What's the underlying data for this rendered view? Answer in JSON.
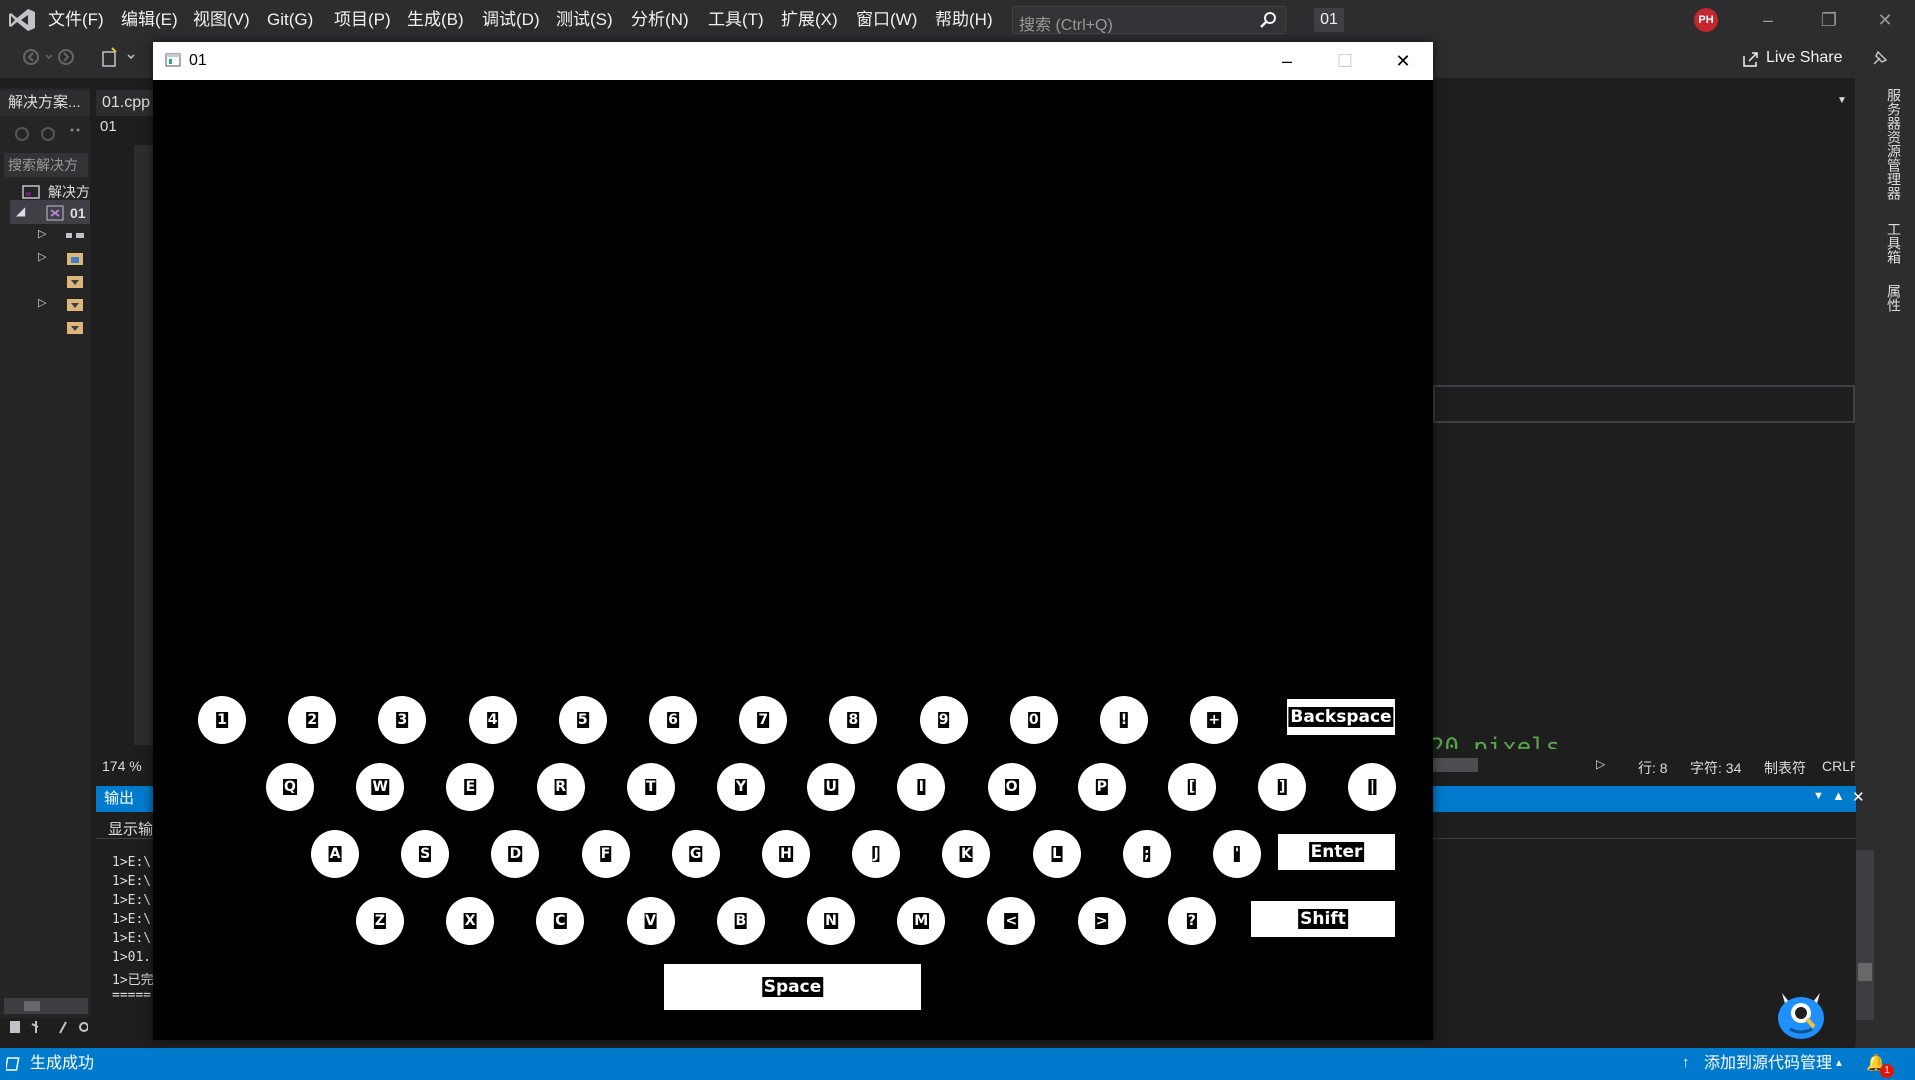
{
  "menubar": {
    "items": [
      "文件(F)",
      "编辑(E)",
      "视图(V)",
      "Git(G)",
      "项目(P)",
      "生成(B)",
      "调试(D)",
      "测试(S)",
      "分析(N)",
      "工具(T)",
      "扩展(X)",
      "窗口(W)",
      "帮助(H)"
    ],
    "search_placeholder": "搜索 (Ctrl+Q)",
    "solution_name": "01",
    "avatar_initials": "PH"
  },
  "toolbar": {
    "live_share": "Live Share"
  },
  "solution_explorer": {
    "header": "解决方案...",
    "search": "搜索解决方",
    "solution_label": "解决方",
    "project_label": "01"
  },
  "editor": {
    "tab": "01.cpp",
    "nav_project": "01",
    "zoom": "174 %",
    "code_fragment": "20 pixels",
    "line": "行: 8",
    "char": "字符: 34",
    "indent": "制表符",
    "eol": "CRLF"
  },
  "right_strip": {
    "tabs": [
      "服务器资源管理器",
      "工具箱",
      "属性"
    ]
  },
  "output_panel": {
    "title": "输出",
    "show_output": "显示输",
    "lines": [
      "1>E:\\",
      "1>E:\\",
      "1>E:\\",
      "1>E:\\",
      "1>E:\\",
      "1>01.",
      "1>已完",
      "====="
    ]
  },
  "statusbar": {
    "build_status": "生成成功",
    "source_control": "添加到源代码管理",
    "notifications": "1"
  },
  "app_window": {
    "title": "01",
    "keyboard": {
      "row1": [
        "1",
        "2",
        "3",
        "4",
        "5",
        "6",
        "7",
        "8",
        "9",
        "0",
        "!",
        "+"
      ],
      "row2": [
        "Q",
        "W",
        "E",
        "R",
        "T",
        "Y",
        "U",
        "I",
        "O",
        "P",
        "[",
        "]",
        "|"
      ],
      "row3": [
        "A",
        "S",
        "D",
        "F",
        "G",
        "H",
        "J",
        "K",
        "L",
        ";",
        "'"
      ],
      "row4": [
        "Z",
        "X",
        "C",
        "V",
        "B",
        "N",
        "M",
        "<",
        ">",
        "?"
      ],
      "backspace": "Backspace",
      "enter": "Enter",
      "shift": "Shift",
      "space": "Space"
    }
  },
  "colors": {
    "accent": "#007acc",
    "chrome": "#2d2d30",
    "editor_bg": "#1e1e1e",
    "code_comment": "#57a64a"
  }
}
